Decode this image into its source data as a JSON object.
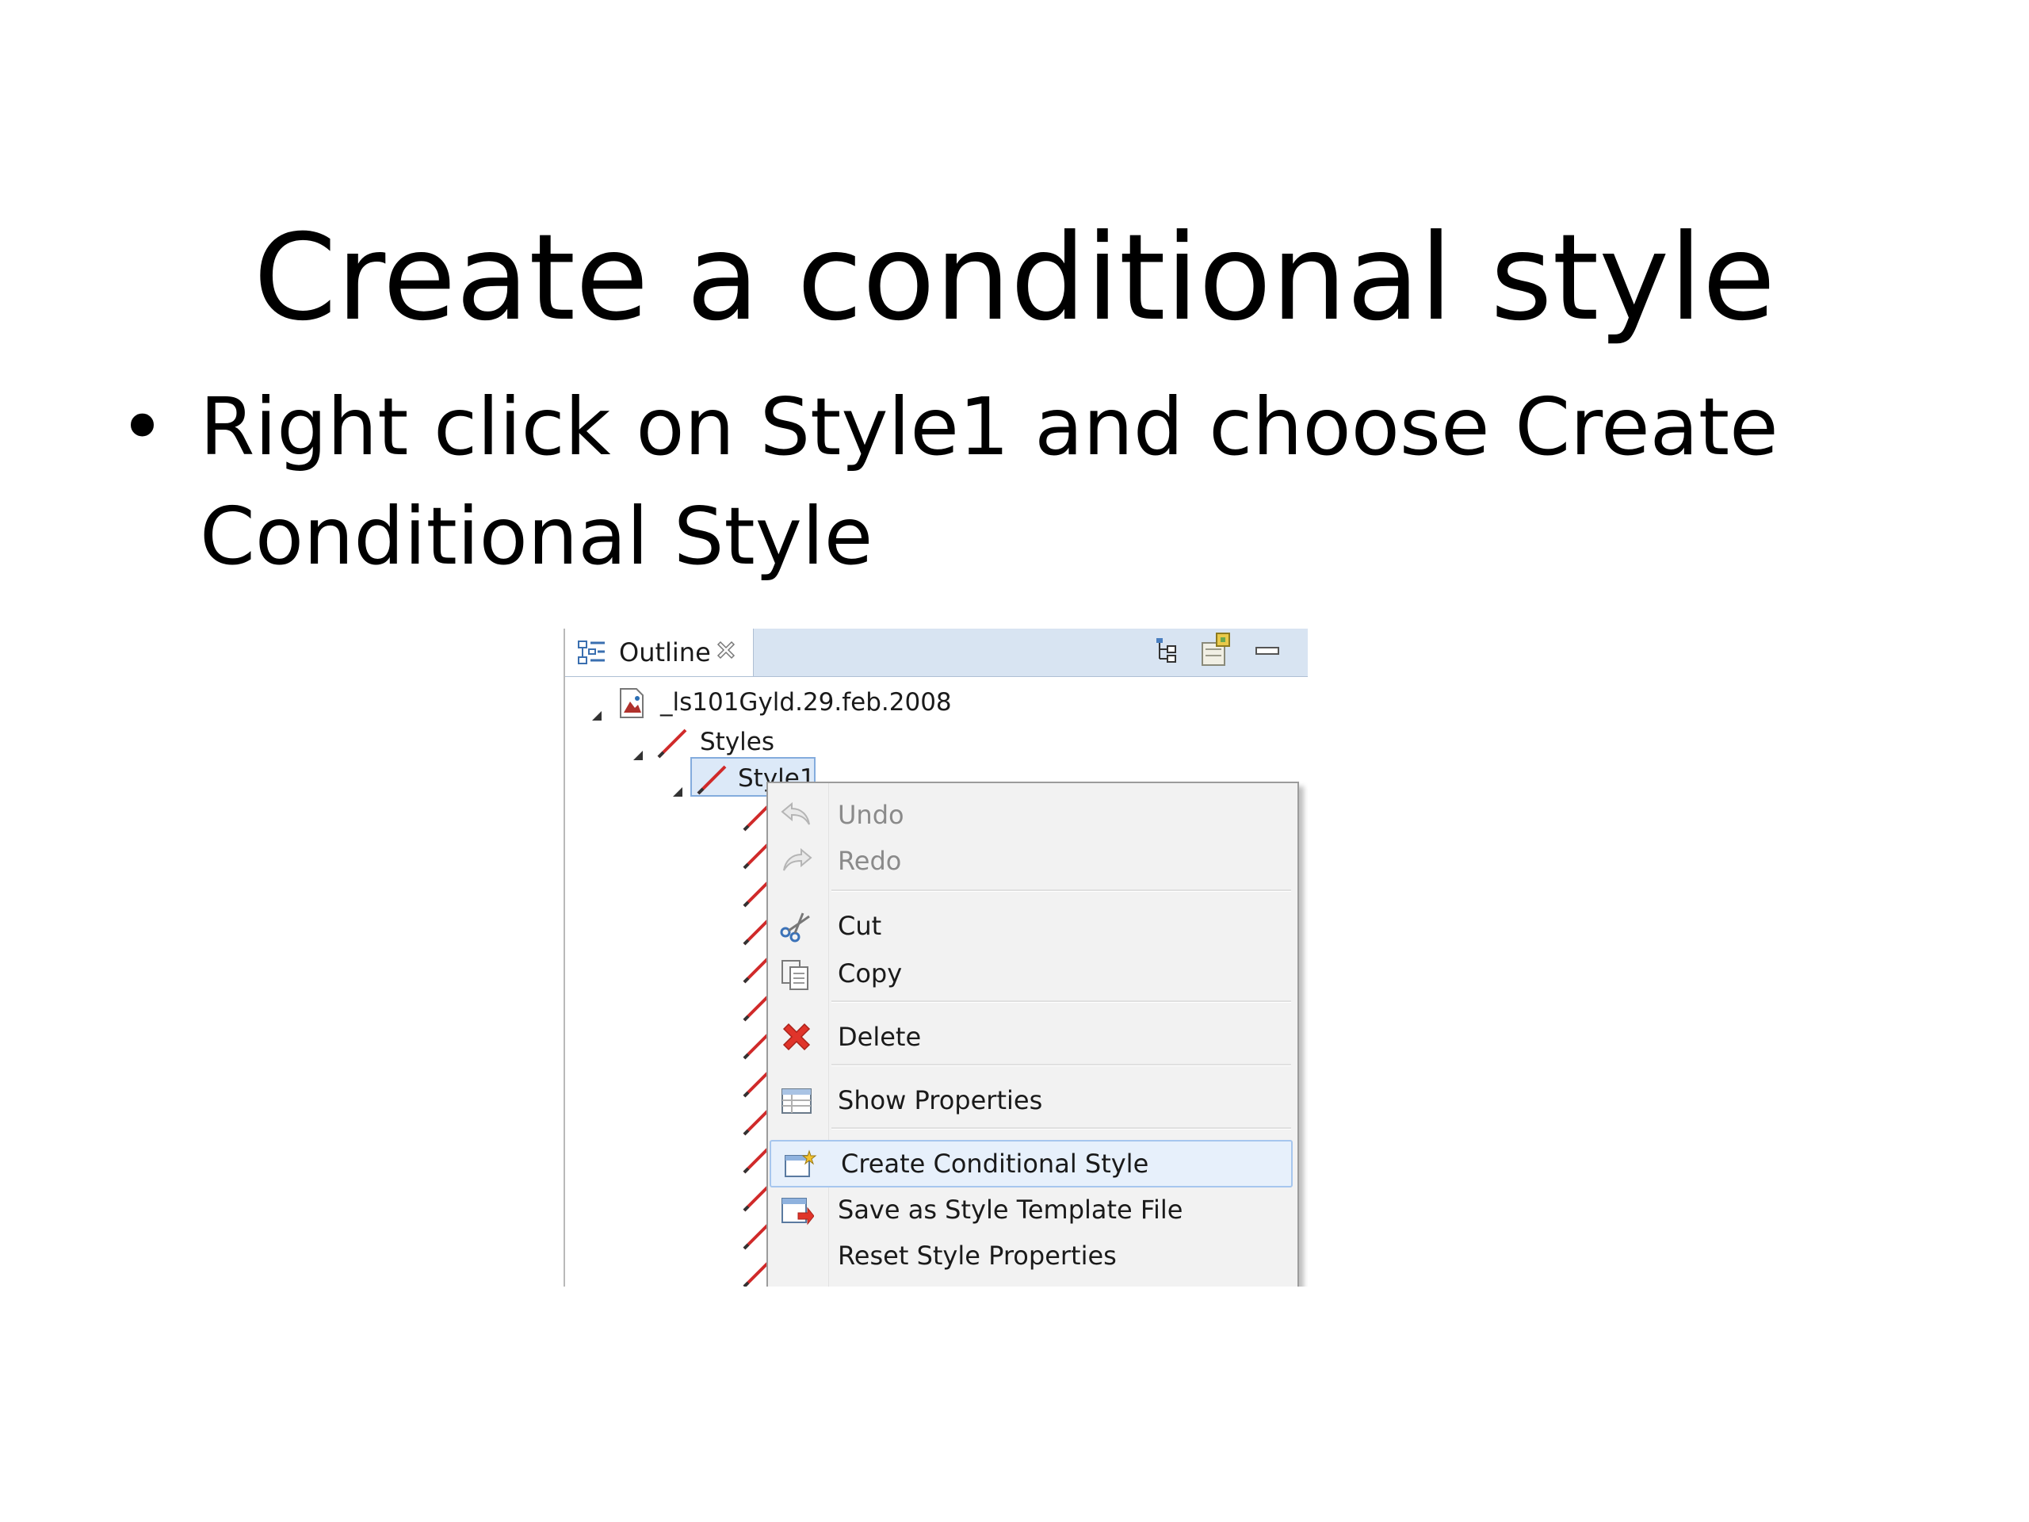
{
  "slide": {
    "title": "Create a conditional style",
    "bullet_symbol": "•",
    "bullet_text": "Right click on Style1 and choose Create Conditional Style"
  },
  "outline": {
    "tab_label": "Outline",
    "tree": {
      "root": "_ls101Gyld.29.feb.2008",
      "styles": "Styles",
      "style1": "Style1"
    }
  },
  "context_menu": {
    "items": [
      {
        "label": "Undo",
        "icon": "undo-icon",
        "enabled": false
      },
      {
        "label": "Redo",
        "icon": "redo-icon",
        "enabled": false
      },
      {
        "label": "Cut",
        "icon": "scissors-icon",
        "enabled": true
      },
      {
        "label": "Copy",
        "icon": "copy-icon",
        "enabled": true
      },
      {
        "label": "Delete",
        "icon": "delete-x-icon",
        "enabled": true
      },
      {
        "label": "Show Properties",
        "icon": "properties-icon",
        "enabled": true
      },
      {
        "label": "Create Conditional Style",
        "icon": "conditional-style-icon",
        "enabled": true,
        "highlighted": true
      },
      {
        "label": "Save as Style Template File",
        "icon": "save-template-icon",
        "enabled": true
      },
      {
        "label": "Reset Style Properties",
        "icon": "",
        "enabled": true
      }
    ]
  },
  "colors": {
    "tab_bar": "#d8e4f2",
    "selection": "#dce9f8",
    "menu_bg": "#f2f2f2",
    "menu_highlight": "#e7f0fb",
    "delete_red": "#e0342a",
    "pencil_red": "#d02a2a"
  }
}
